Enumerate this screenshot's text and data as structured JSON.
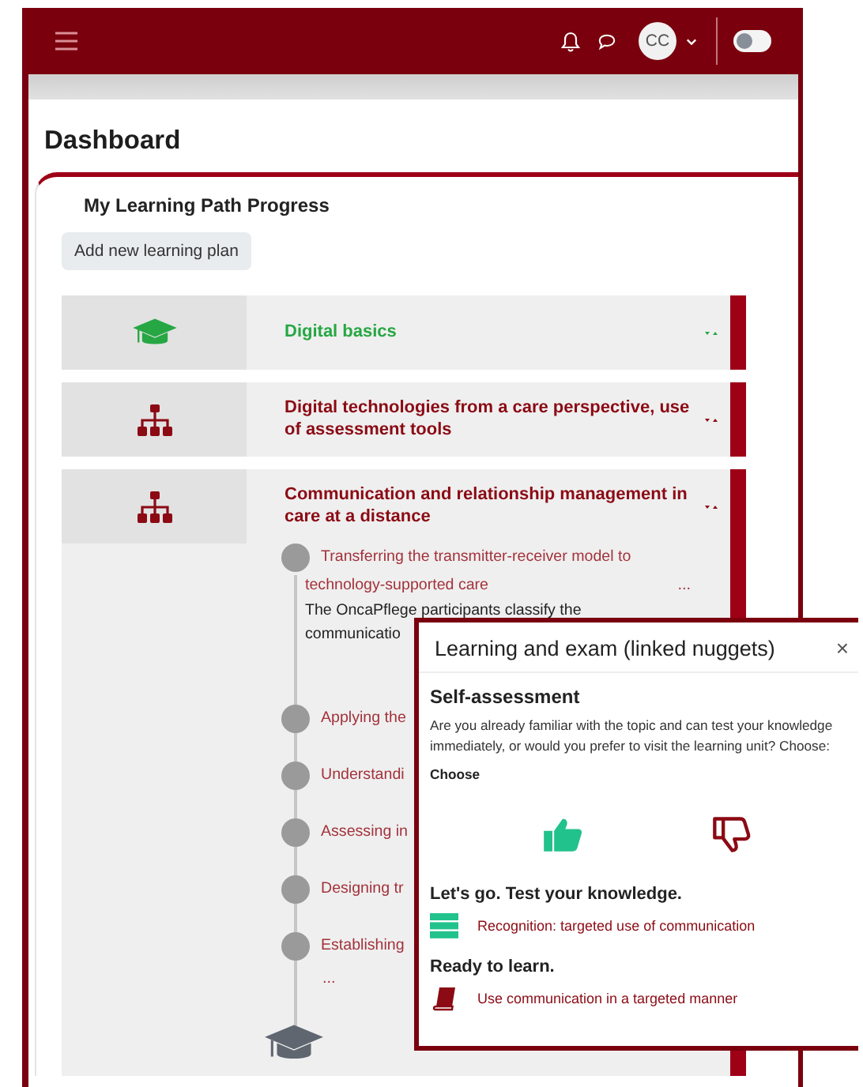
{
  "header": {
    "avatar": "CC",
    "toggle": {
      "on": false
    }
  },
  "page": {
    "title": "Dashboard"
  },
  "card": {
    "title": "My Learning Path Progress",
    "add_button": "Add new learning plan",
    "paths": [
      {
        "title": "Digital basics",
        "kind": "graduation",
        "completed": true,
        "expanded": false
      },
      {
        "title": "Digital technologies from a care perspective, use of assessment tools",
        "kind": "hierarchy",
        "completed": false,
        "expanded": false
      },
      {
        "title": "Communication and relationship management in care at a distance",
        "kind": "hierarchy",
        "completed": false,
        "expanded": true,
        "more": "...",
        "nuggets": [
          {
            "title": "Transferring the transmitter-receiver model to technology-supported care",
            "more": "...",
            "description": "The OncaPflege participants classify the communicatio"
          },
          {
            "title": "Applying the"
          },
          {
            "title": "Understandi"
          },
          {
            "title": "Assessing in"
          },
          {
            "title": "Designing tr"
          },
          {
            "title": "Establishing"
          }
        ]
      }
    ]
  },
  "popup": {
    "title": "Learning and exam (linked nuggets)",
    "close": "×",
    "heading": "Self-assessment",
    "question": "Are you already familiar with the topic and can test your knowledge immediately, or would you prefer to visit the learning unit? Choose:",
    "choose": "Choose",
    "sections": [
      {
        "heading": "Let's go. Test your knowledge.",
        "kind": "quiz",
        "link": "Recognition: targeted use of communication"
      },
      {
        "heading": "Ready to learn.",
        "kind": "book",
        "link": "Use communication in a targeted manner"
      }
    ]
  }
}
